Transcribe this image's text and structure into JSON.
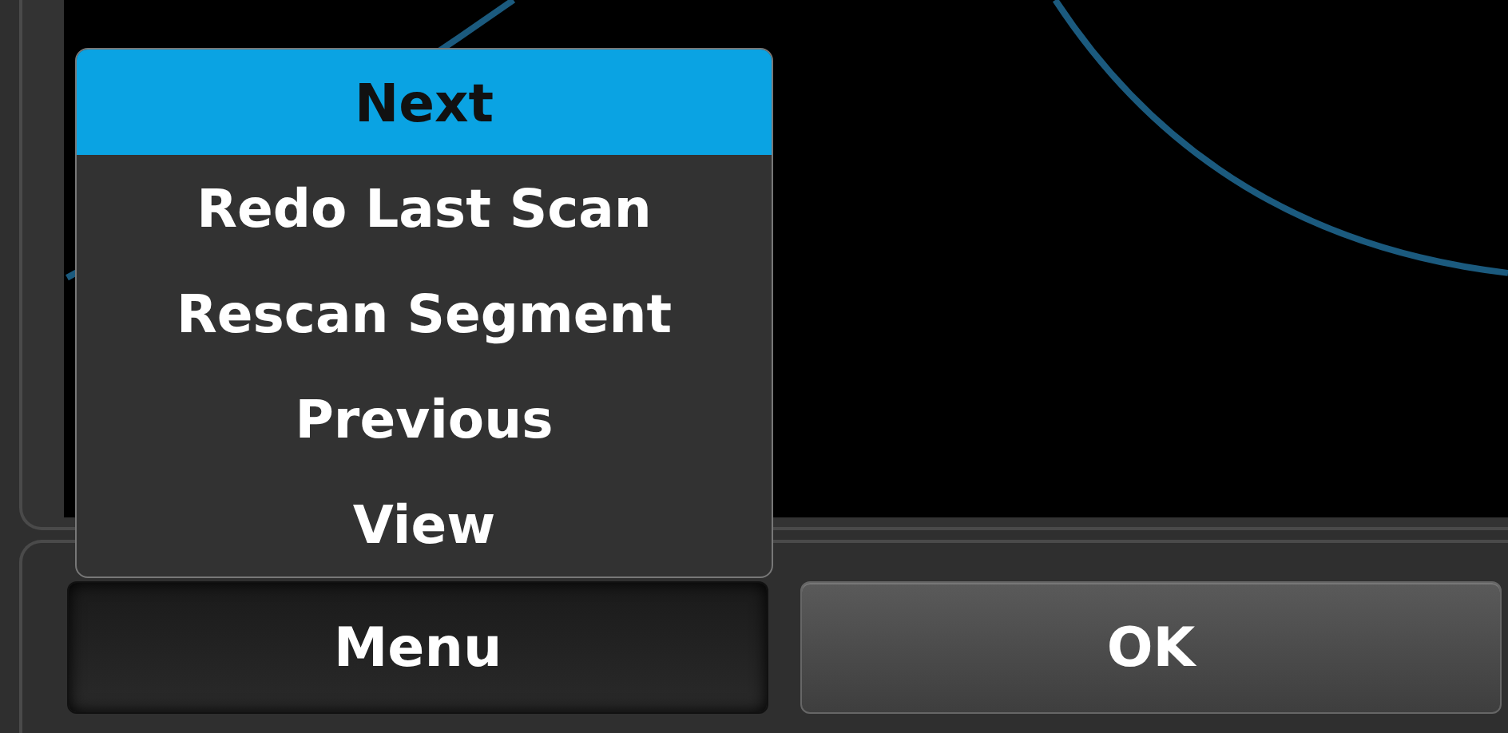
{
  "menu": {
    "open": true,
    "items": [
      {
        "label": "Next",
        "selected": true
      },
      {
        "label": "Redo Last Scan",
        "selected": false
      },
      {
        "label": "Rescan Segment",
        "selected": false
      },
      {
        "label": "Previous",
        "selected": false
      },
      {
        "label": "View",
        "selected": false
      }
    ]
  },
  "buttons": [
    {
      "label": "Menu",
      "pressed": true
    },
    {
      "label": "OK",
      "pressed": false
    }
  ]
}
